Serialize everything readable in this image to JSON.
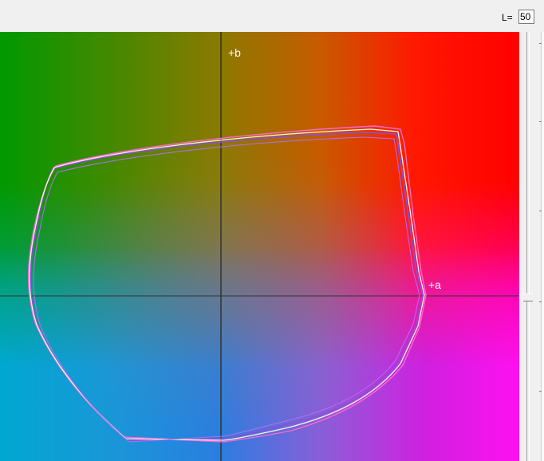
{
  "controls": {
    "lightness_label": "L=",
    "lightness_value": "50"
  },
  "plot": {
    "a_axis_label": "+a",
    "b_axis_label": "+b"
  },
  "colors": {
    "outline_purple": "#8a4fd8",
    "outline_pink": "#ff66cc",
    "outline_white": "#fff4e8",
    "axis_line": "#333333"
  }
}
